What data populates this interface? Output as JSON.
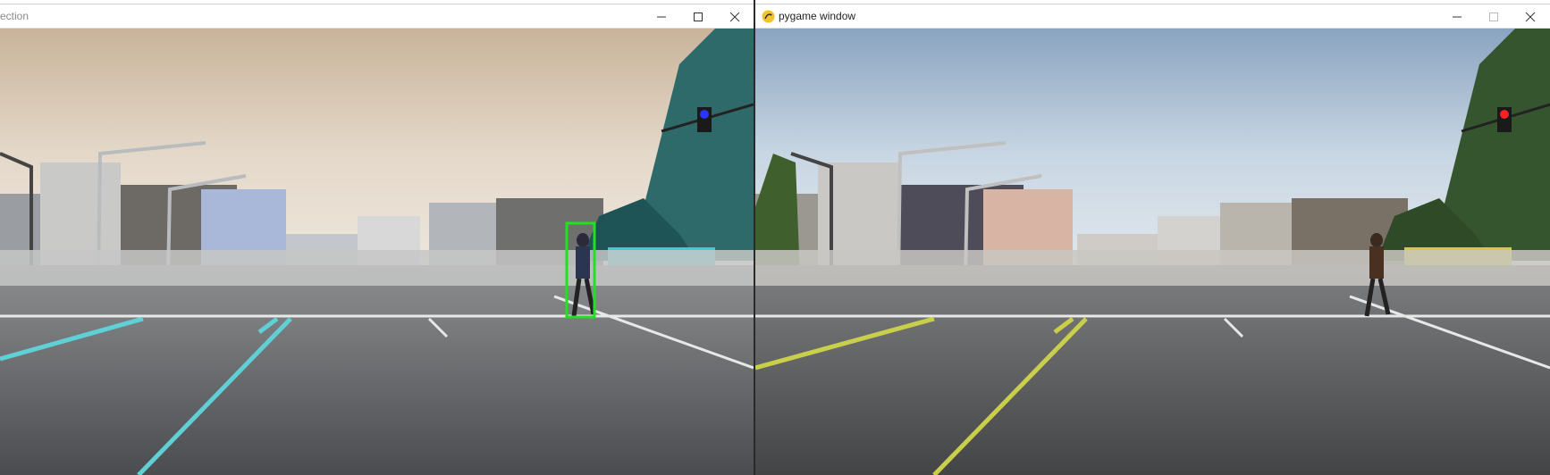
{
  "left_window": {
    "title": "ection",
    "title_color": "#8a8a8a",
    "controls": [
      "minimize-icon",
      "maximize-icon",
      "close-icon"
    ],
    "detections": [
      {
        "label": "pedestrian",
        "box_color": "#22e022"
      }
    ],
    "tint": "cyan"
  },
  "right_window": {
    "title": "pygame window",
    "icon": "pygame-snake-icon",
    "controls": [
      "minimize-icon",
      "maximize-icon",
      "close-icon"
    ],
    "tint": "yellow"
  },
  "colors": {
    "titlebar_bg": "#ffffff",
    "detection_box": "#22e022",
    "traffic_light_left": "#2a35ff",
    "traffic_light_right": "#ff2020"
  }
}
